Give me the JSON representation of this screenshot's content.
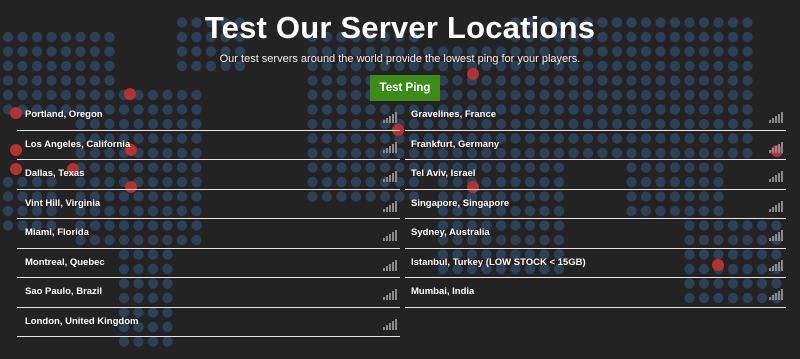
{
  "header": {
    "title": "Test Our Server Locations",
    "subtitle": "Our test servers around the world provide the lowest ping for your players.",
    "button_label": "Test Ping"
  },
  "colors": {
    "background": "#232323",
    "map_dot": "#2c4056",
    "marker_dot": "#b43232",
    "button": "#3c8c17",
    "divider": "#e6e6e6"
  },
  "servers": {
    "left": [
      {
        "name": "Portland, Oregon",
        "icon": "signal-bars-icon"
      },
      {
        "name": "Los Angeles, California",
        "icon": "signal-bars-icon"
      },
      {
        "name": "Dallas, Texas",
        "icon": "signal-bars-icon"
      },
      {
        "name": "Vint Hill, Virginia",
        "icon": "signal-bars-icon"
      },
      {
        "name": "Miami, Florida",
        "icon": "signal-bars-icon"
      },
      {
        "name": "Montreal, Quebec",
        "icon": "signal-bars-icon"
      },
      {
        "name": "Sao Paulo, Brazil",
        "icon": "signal-bars-icon"
      },
      {
        "name": "London, United Kingdom",
        "icon": "signal-bars-icon"
      }
    ],
    "right": [
      {
        "name": "Gravelines, France",
        "icon": "signal-bars-icon"
      },
      {
        "name": "Frankfurt, Germany",
        "icon": "signal-bars-icon"
      },
      {
        "name": "Tel Aviv, Israel",
        "icon": "signal-bars-icon"
      },
      {
        "name": "Singapore, Singapore",
        "icon": "signal-bars-icon"
      },
      {
        "name": "Sydney, Australia",
        "icon": "signal-bars-icon"
      },
      {
        "name": "Istanbul, Turkey (LOW STOCK < 15GB)",
        "icon": "signal-bars-icon"
      },
      {
        "name": "Mumbai, India",
        "icon": "signal-bars-icon"
      }
    ]
  }
}
